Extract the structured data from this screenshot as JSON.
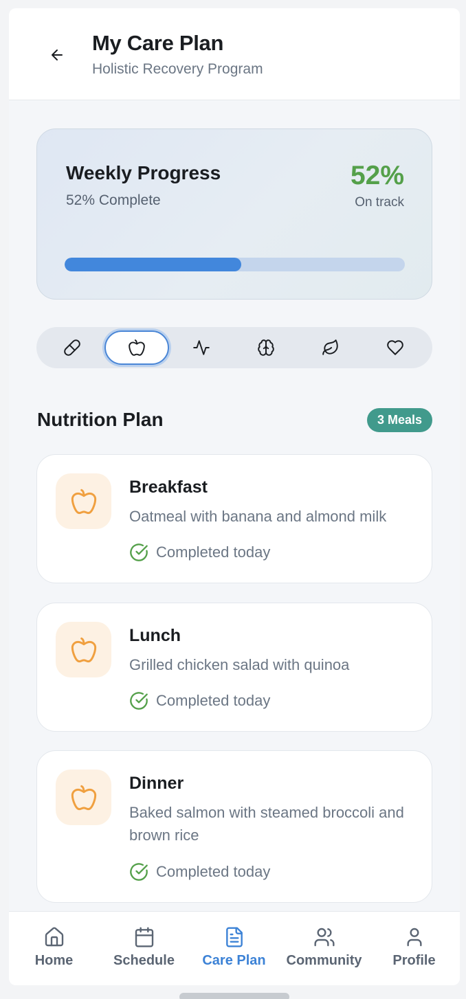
{
  "header": {
    "title": "My Care Plan",
    "subtitle": "Holistic Recovery Program"
  },
  "progress": {
    "title": "Weekly Progress",
    "subtitle": "52% Complete",
    "percent_label": "52%",
    "status": "On track",
    "value": 0.52
  },
  "tabs": [
    {
      "icon": "pill-icon",
      "active": false
    },
    {
      "icon": "apple-icon",
      "active": true
    },
    {
      "icon": "activity-icon",
      "active": false
    },
    {
      "icon": "brain-icon",
      "active": false
    },
    {
      "icon": "leaf-icon",
      "active": false
    },
    {
      "icon": "heart-icon",
      "active": false
    }
  ],
  "section": {
    "title": "Nutrition Plan",
    "badge": "3 Meals"
  },
  "meals": [
    {
      "name": "Breakfast",
      "description": "Oatmeal with banana and almond milk",
      "status": "Completed today",
      "icon": "apple-icon"
    },
    {
      "name": "Lunch",
      "description": "Grilled chicken salad with quinoa",
      "status": "Completed today",
      "icon": "apple-icon"
    },
    {
      "name": "Dinner",
      "description": "Baked salmon with steamed broccoli and brown rice",
      "status": "Completed today",
      "icon": "apple-icon"
    }
  ],
  "nav": [
    {
      "label": "Home",
      "icon": "home-icon",
      "active": false
    },
    {
      "label": "Schedule",
      "icon": "calendar-icon",
      "active": false
    },
    {
      "label": "Care Plan",
      "icon": "document-icon",
      "active": true
    },
    {
      "label": "Community",
      "icon": "users-icon",
      "active": false
    },
    {
      "label": "Profile",
      "icon": "user-icon",
      "active": false
    }
  ],
  "colors": {
    "accent_blue": "#3c82d6",
    "progress_green": "#54a04a",
    "badge_teal": "#419a8c",
    "meal_orange": "#f0a040",
    "check_green": "#54a04a"
  }
}
